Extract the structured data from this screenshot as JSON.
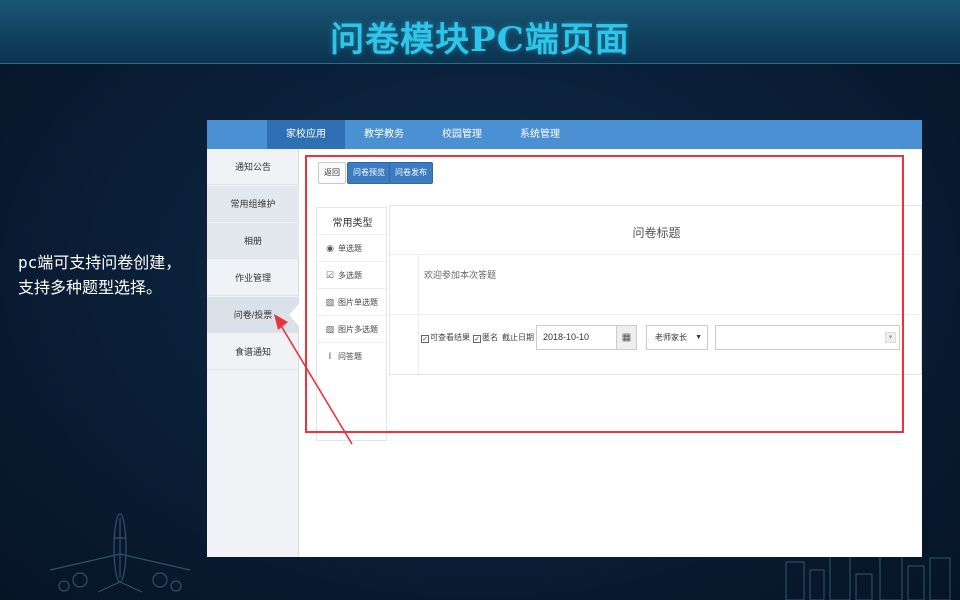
{
  "slide": {
    "title": "问卷模块PC端页面",
    "description": "pc端可支持问卷创建，支持多种题型选择。"
  },
  "colors": {
    "title": "#2ec5ea",
    "nav_bar": "#4a90d2",
    "nav_active": "#2f6fb3",
    "button_blue": "#3b7cc1",
    "highlight_red": "#e8343c"
  },
  "app": {
    "topnav": [
      "家校应用",
      "教学教务",
      "校园管理",
      "系统管理"
    ],
    "sidebar": [
      "通知公告",
      "常用组维护",
      "相册",
      "作业管理",
      "问卷/投票",
      "食谱通知"
    ],
    "toolbar": {
      "back": "返回",
      "preview": "问卷预览",
      "publish": "问卷发布"
    },
    "question_types": {
      "header": "常用类型",
      "items": [
        {
          "label": "单选题",
          "icon": "radio-icon"
        },
        {
          "label": "多选题",
          "icon": "checkbox-icon"
        },
        {
          "label": "图片单选题",
          "icon": "image-icon"
        },
        {
          "label": "图片多选题",
          "icon": "image-icon"
        },
        {
          "label": "问答题",
          "icon": "text-input-icon"
        }
      ]
    },
    "survey": {
      "title": "问卷标题",
      "welcome": "欢迎参加本次答题",
      "options": {
        "view_results": "可查看结果",
        "anonymous": "匿名",
        "deadline_label": "截止日期",
        "deadline_value": "2018-10-10",
        "audience": "老师家长"
      }
    }
  }
}
